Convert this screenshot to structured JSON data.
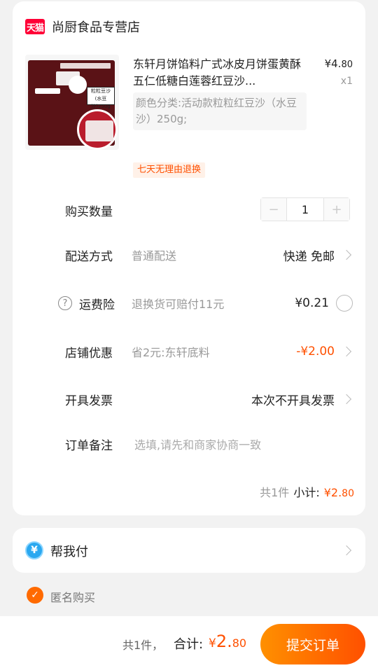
{
  "store": {
    "badge": "天猫",
    "name": "尚厨食品专营店"
  },
  "product": {
    "title": "东轩月饼馅料广式冰皮月饼蛋黄酥五仁低糖白莲蓉红豆沙...",
    "price_int": "¥4.",
    "price_dec": "80",
    "qty": "x1",
    "sku": "颜色分类:活动款粒粒红豆沙（水豆沙）250g;",
    "package_label": "粒粒豆沙 (水豆沙)250g",
    "return_policy": "七天无理由退换"
  },
  "quantity": {
    "label": "购买数量",
    "minus": "−",
    "value": "1",
    "plus": "+"
  },
  "delivery": {
    "label": "配送方式",
    "method": "普通配送",
    "value": "快递 免邮"
  },
  "insurance": {
    "icon": "?",
    "label": "运费险",
    "desc": "退换货可赔付11元",
    "price": "¥0.21"
  },
  "discount": {
    "label": "店铺优惠",
    "desc": "省2元:东轩底料",
    "value": "-¥2.00"
  },
  "invoice": {
    "label": "开具发票",
    "value": "本次不开具发票"
  },
  "note": {
    "label": "订单备注",
    "placeholder": "选填,请先和商家协商一致"
  },
  "subtotal": {
    "count": "共1件",
    "label": "小计:",
    "amount_int": "¥2.",
    "amount_dec": "80"
  },
  "help_pay": {
    "icon": "¥",
    "label": "帮我付"
  },
  "anonymous": {
    "check": "✓",
    "label": "匿名购买"
  },
  "footer": {
    "count": "共1件，",
    "total_label": "合计:",
    "yen": "¥",
    "amount_int": "2.",
    "amount_dec": "80",
    "submit": "提交订单"
  },
  "colors": {
    "accent": "#ff5000",
    "tmall": "#ff0036"
  }
}
